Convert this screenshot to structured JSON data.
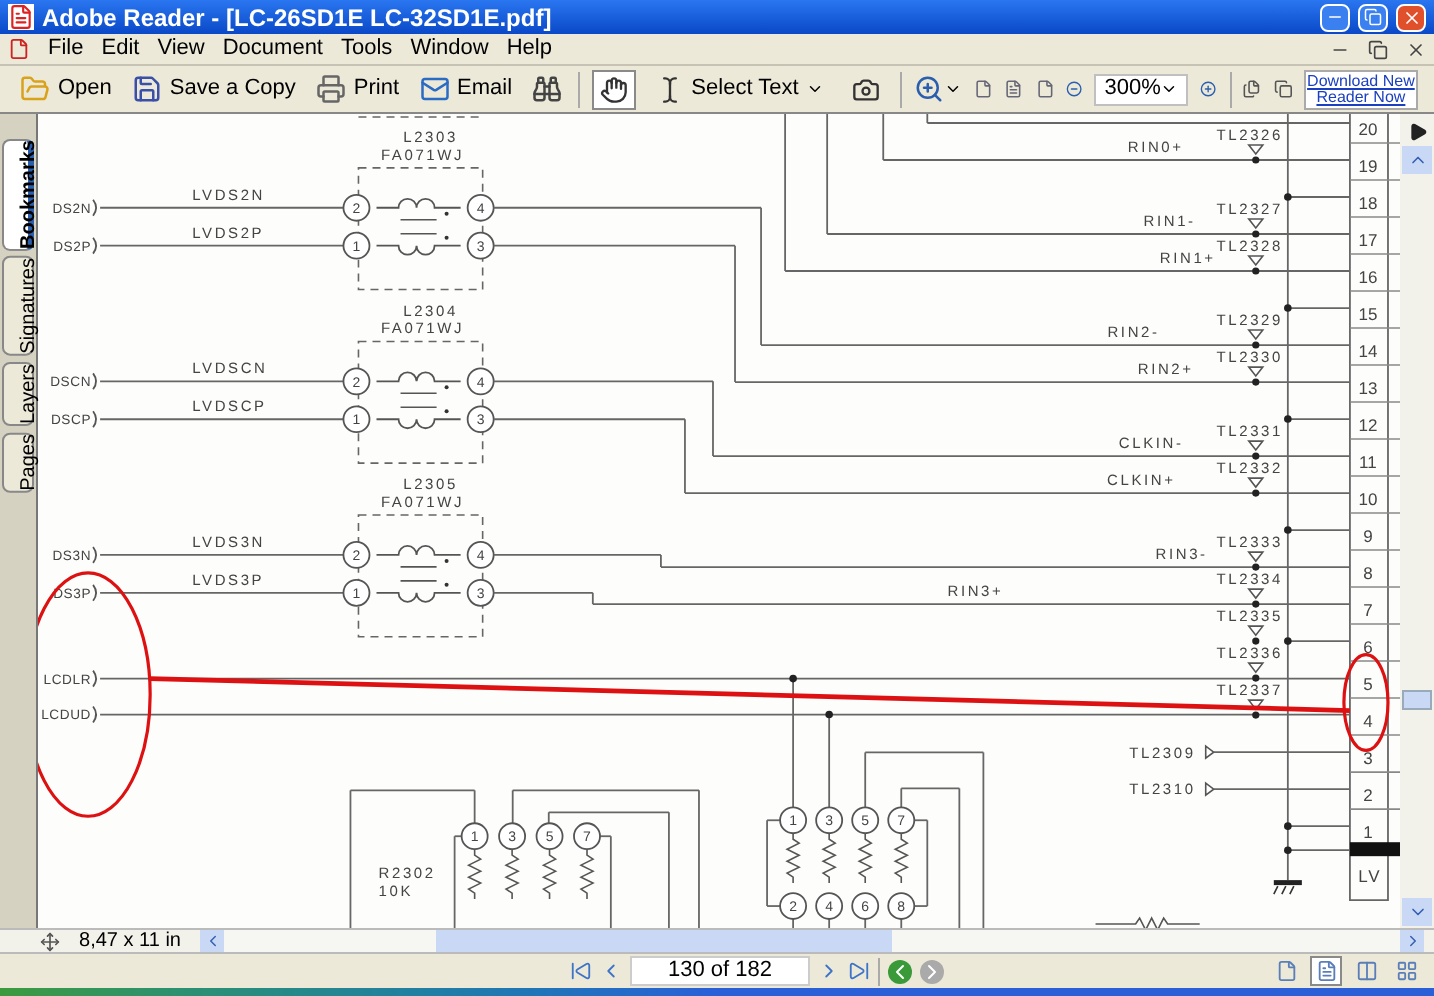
{
  "window": {
    "title": "Adobe Reader - [LC-26SD1E  LC-32SD1E.pdf]"
  },
  "menu": [
    "File",
    "Edit",
    "View",
    "Document",
    "Tools",
    "Window",
    "Help"
  ],
  "toolbar": {
    "file_buttons": [
      {
        "kind": "open",
        "label": "Open"
      },
      {
        "kind": "save",
        "label": "Save a Copy"
      },
      {
        "kind": "print",
        "label": "Print"
      },
      {
        "kind": "email",
        "label": "Email"
      },
      {
        "kind": "search"
      }
    ],
    "tools": [
      {
        "kind": "hand",
        "selected": true
      },
      {
        "kind": "select_text",
        "label": "Select Text",
        "selected": false
      },
      {
        "kind": "snapshot",
        "selected": false
      }
    ],
    "zoom": "300%",
    "promo": "Download New Reader Now"
  },
  "side_tabs": [
    {
      "label": "Bookmarks",
      "selected": true
    },
    {
      "label": "Signatures",
      "selected": false
    },
    {
      "label": "Layers",
      "selected": false
    },
    {
      "label": "Pages",
      "selected": false
    }
  ],
  "schematic": {
    "left_ports": [
      "DS2N",
      "DS2P",
      "DSCN",
      "DSCP",
      "DS3N",
      "DS3P",
      "LCDLR",
      "LCDUD"
    ],
    "net_labels": [
      "LVDS2N",
      "LVDS2P",
      "LVDSCN",
      "LVDSCP",
      "LVDS3N",
      "LVDS3P"
    ],
    "inductors": [
      {
        "ref": "L2303",
        "part": "FA071WJ",
        "pins": [
          "2",
          "4",
          "1",
          "3"
        ]
      },
      {
        "ref": "L2304",
        "part": "FA071WJ",
        "pins": [
          "2",
          "4",
          "1",
          "3"
        ]
      },
      {
        "ref": "L2305",
        "part": "FA071WJ",
        "pins": [
          "2",
          "4",
          "1",
          "3"
        ]
      }
    ],
    "right_nets": [
      "RIN0+",
      "RIN1-",
      "RIN1+",
      "RIN2-",
      "RIN2+",
      "CLKIN-",
      "CLKIN+",
      "RIN3-",
      "RIN3+"
    ],
    "test_points": [
      "TL2326",
      "TL2327",
      "TL2328",
      "TL2329",
      "TL2330",
      "TL2331",
      "TL2332",
      "TL2333",
      "TL2334",
      "TL2335",
      "TL2336",
      "TL2337"
    ],
    "outputs": [
      "TL2309",
      "TL2310"
    ],
    "connector": {
      "pins": [
        "20",
        "19",
        "18",
        "17",
        "16",
        "15",
        "14",
        "13",
        "12",
        "11",
        "10",
        "9",
        "8",
        "7",
        "6",
        "5",
        "4",
        "3",
        "2",
        "1"
      ],
      "label": "LV"
    },
    "resistor_packs": [
      {
        "ref": "R2302",
        "value": "10K",
        "pins": [
          "1",
          "3",
          "5",
          "7"
        ]
      },
      {
        "pins": [
          "1",
          "3",
          "5",
          "7",
          "2",
          "4",
          "6",
          "8"
        ]
      }
    ]
  },
  "page_size": "8,47 x 11 in",
  "page_nav": "130 of 182",
  "view_modes": [
    {
      "kind": "single",
      "selected": false
    },
    {
      "kind": "continuous",
      "selected": true
    },
    {
      "kind": "facing",
      "selected": false
    },
    {
      "kind": "continuous_facing",
      "selected": false
    }
  ]
}
